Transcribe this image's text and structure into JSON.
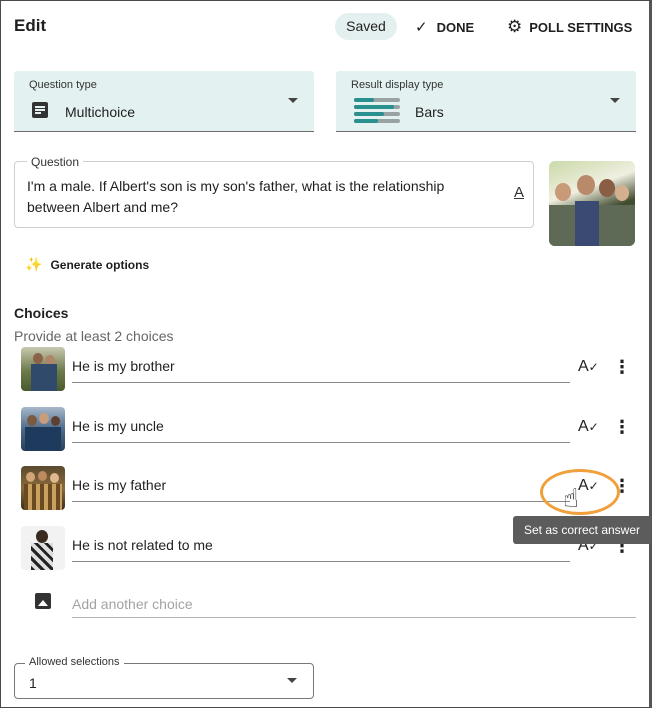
{
  "header": {
    "title": "Edit",
    "saved_label": "Saved",
    "done_label": "DONE",
    "poll_settings_label": "POLL SETTINGS"
  },
  "question_type": {
    "label": "Question type",
    "value": "Multichoice",
    "icon": "list-icon"
  },
  "result_display_type": {
    "label": "Result display type",
    "value": "Bars",
    "icon": "bars-chart-icon"
  },
  "question": {
    "label": "Question",
    "text": "I'm a male. If Albert's son is my son's father, what is the relationship between Albert and me?",
    "format_icon": "A"
  },
  "generate_options_label": "Generate options",
  "choices": {
    "heading": "Choices",
    "subtext": "Provide at least 2 choices",
    "items": [
      {
        "label": "He is my brother"
      },
      {
        "label": "He is my uncle"
      },
      {
        "label": "He is my father"
      },
      {
        "label": "He is not related to me"
      }
    ],
    "add_placeholder": "Add another choice"
  },
  "allowed_selections": {
    "label": "Allowed selections",
    "value": "1"
  },
  "tooltip": "Set as correct answer",
  "colors": {
    "select_bg": "#e3f1f1",
    "accent_teal": "#2a8f8f",
    "highlight": "#f0a03a",
    "tooltip_bg": "#5c5c5c"
  }
}
